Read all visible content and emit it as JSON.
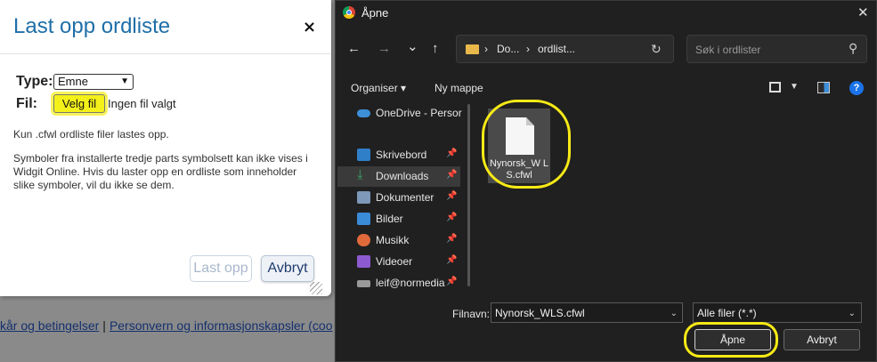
{
  "web_page": {
    "footer": {
      "link_terms": "kår og betingelser",
      "separator": "|",
      "link_privacy": "Personvern og informasjonskapsler (coo"
    }
  },
  "web_dialog": {
    "title": "Last opp ordliste",
    "close": "×",
    "type_label": "Type:",
    "type_value": "Emne",
    "file_label": "Fil:",
    "choose_file": "Velg fil",
    "file_status": "Ingen fil valgt",
    "info_short": "Kun .cfwl ordliste filer lastes opp.",
    "info_long": "Symboler fra installerte tredje parts symbolsett kan ikke vises i Widgit Online. Hvis du laster opp en ordliste som inneholder slike symboler, vil du ikke se dem.",
    "upload_button": "Last opp",
    "cancel_button": "Avbryt"
  },
  "file_dialog": {
    "title": "Åpne",
    "close": "✕",
    "nav": {
      "back": "←",
      "forward": "→",
      "dropdown": "⌄",
      "up": "↑"
    },
    "breadcrumb": [
      "Do...",
      "ordlist..."
    ],
    "breadcrumb_sep": "›",
    "refresh": "↻",
    "search_placeholder": "Søk i ordlister",
    "toolbar": {
      "organize": "Organiser",
      "organize_chevron": "▾",
      "new_folder": "Ny mappe",
      "help": "?"
    },
    "sidebar": [
      {
        "label": "OneDrive - Persor",
        "icon": "onedrive-icon",
        "color": "#3d8fd8",
        "pinned": false,
        "pin": ""
      },
      {
        "label": "Skrivebord",
        "icon": "desktop-icon",
        "color": "#2f7fc8",
        "pinned": true,
        "pin": "📌"
      },
      {
        "label": "Downloads",
        "icon": "download-icon",
        "color": "#3aa36a",
        "pinned": true,
        "pin": "📌",
        "selected": true
      },
      {
        "label": "Dokumenter",
        "icon": "documents-icon",
        "color": "#7d98b8",
        "pinned": true,
        "pin": "📌"
      },
      {
        "label": "Bilder",
        "icon": "pictures-icon",
        "color": "#3a8bd8",
        "pinned": true,
        "pin": "📌"
      },
      {
        "label": "Musikk",
        "icon": "music-icon",
        "color": "#e06a3a",
        "pinned": true,
        "pin": "📌"
      },
      {
        "label": "Videoer",
        "icon": "videos-icon",
        "color": "#8e5ad0",
        "pinned": true,
        "pin": "📌"
      },
      {
        "label": "leif@normedia",
        "icon": "drive-icon",
        "color": "#9a9a9a",
        "pinned": true,
        "pin": "📌"
      }
    ],
    "files": [
      {
        "name": "Nynorsk_WLS.cfwl",
        "name_display": "Nynorsk_W LS.cfwl",
        "icon": "file-icon"
      }
    ],
    "filename_label": "Filnavn:",
    "filename_value": "Nynorsk_WLS.cfwl",
    "filter_value": "Alle filer (*.*)",
    "combo_chevron": "⌄",
    "open_button": "Åpne",
    "cancel_button": "Avbryt"
  },
  "colors": {
    "highlight_ring": "#f8ea16",
    "accent_title": "#1f6fa8",
    "choose_file_bg": "#f4f01a"
  }
}
